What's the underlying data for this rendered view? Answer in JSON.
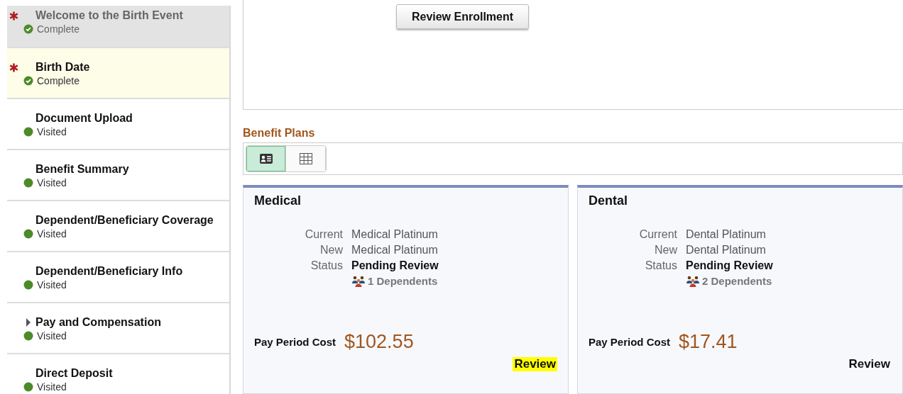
{
  "sidebar": {
    "items": [
      {
        "title": "Welcome to the Birth Event",
        "status": "Complete",
        "kind": "complete",
        "required": true,
        "selected": false,
        "disabled": true
      },
      {
        "title": "Birth Date",
        "status": "Complete",
        "kind": "complete",
        "required": true,
        "selected": true,
        "disabled": false
      },
      {
        "title": "Document Upload",
        "status": "Visited",
        "kind": "visited",
        "required": false,
        "selected": false,
        "disabled": false
      },
      {
        "title": "Benefit Summary",
        "status": "Visited",
        "kind": "visited",
        "required": false,
        "selected": false,
        "disabled": false
      },
      {
        "title": "Dependent/Beneficiary Coverage",
        "status": "Visited",
        "kind": "visited",
        "required": false,
        "selected": false,
        "disabled": false
      },
      {
        "title": "Dependent/Beneficiary Info",
        "status": "Visited",
        "kind": "visited",
        "required": false,
        "selected": false,
        "disabled": false
      },
      {
        "title": "Pay and Compensation",
        "status": "Visited",
        "kind": "visited",
        "required": false,
        "selected": false,
        "disabled": false,
        "expanded": false
      },
      {
        "title": "Direct Deposit",
        "status": "Visited",
        "kind": "visited",
        "required": false,
        "selected": false,
        "disabled": false
      }
    ]
  },
  "review_enrollment_button": "Review Enrollment",
  "benefit_plans": {
    "heading": "Benefit Plans",
    "views": [
      {
        "kind": "cards",
        "selected": true
      },
      {
        "kind": "grid",
        "selected": false
      }
    ],
    "cards": [
      {
        "title": "Medical",
        "fields": [
          {
            "label": "Current",
            "value": "Medical Platinum",
            "bold": false
          },
          {
            "label": "New",
            "value": "Medical Platinum",
            "bold": false
          },
          {
            "label": "Status",
            "value": "Pending Review",
            "bold": true
          }
        ],
        "dependents": "1 Dependents",
        "cost_label": "Pay Period Cost",
        "cost": "$102.55",
        "review": "Review",
        "highlighted": true
      },
      {
        "title": "Dental",
        "fields": [
          {
            "label": "Current",
            "value": "Dental Platinum",
            "bold": false
          },
          {
            "label": "New",
            "value": "Dental Platinum",
            "bold": false
          },
          {
            "label": "Status",
            "value": "Pending Review",
            "bold": true
          }
        ],
        "dependents": "2 Dependents",
        "cost_label": "Pay Period Cost",
        "cost": "$17.41",
        "review": "Review",
        "highlighted": false
      }
    ]
  }
}
